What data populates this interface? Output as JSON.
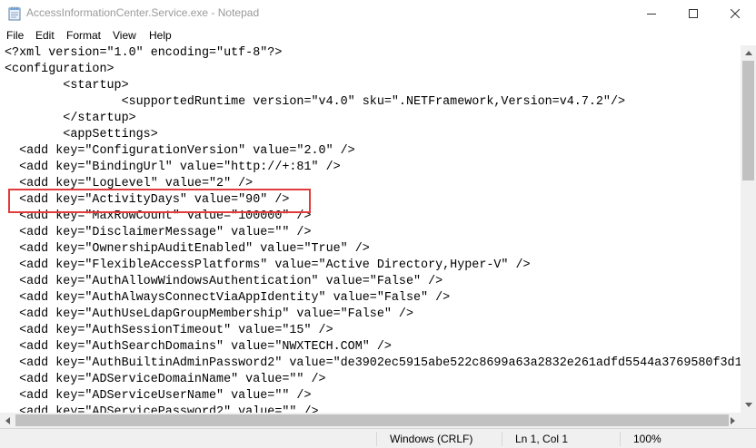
{
  "window": {
    "title": "AccessInformationCenter.Service.exe - Notepad",
    "icon": "notepad-icon",
    "controls": [
      "minimize-icon",
      "maximize-icon",
      "close-icon"
    ]
  },
  "menu": [
    "File",
    "Edit",
    "Format",
    "View",
    "Help"
  ],
  "editor": {
    "lines": [
      "<?xml version=\"1.0\" encoding=\"utf-8\"?>",
      "<configuration>",
      "        <startup>",
      "                <supportedRuntime version=\"v4.0\" sku=\".NETFramework,Version=v4.7.2\"/>",
      "        </startup>",
      "        <appSettings>",
      "  <add key=\"ConfigurationVersion\" value=\"2.0\" />",
      "  <add key=\"BindingUrl\" value=\"http://+:81\" />",
      "  <add key=\"LogLevel\" value=\"2\" />",
      "  <add key=\"ActivityDays\" value=\"90\" />",
      "  <add key=\"MaxRowCount\" value=\"100000\" />",
      "  <add key=\"DisclaimerMessage\" value=\"\" />",
      "  <add key=\"OwnershipAuditEnabled\" value=\"True\" />",
      "  <add key=\"FlexibleAccessPlatforms\" value=\"Active Directory,Hyper-V\" />",
      "  <add key=\"AuthAllowWindowsAuthentication\" value=\"False\" />",
      "  <add key=\"AuthAlwaysConnectViaAppIdentity\" value=\"False\" />",
      "  <add key=\"AuthUseLdapGroupMembership\" value=\"False\" />",
      "  <add key=\"AuthSessionTimeout\" value=\"15\" />",
      "  <add key=\"AuthSearchDomains\" value=\"NWXTECH.COM\" />",
      "  <add key=\"AuthBuiltinAdminPassword2\" value=\"de3902ec5915abe522c8699a63a2832e261adfd5544a3769580f3d1",
      "  <add key=\"ADServiceDomainName\" value=\"\" />",
      "  <add key=\"ADServiceUserName\" value=\"\" />",
      "  <add key=\"ADServicePassword2\" value=\"\" />"
    ],
    "highlighted_line": 9,
    "highlight_color": "#e23b3b"
  },
  "status": {
    "line_endings": "Windows (CRLF)",
    "position": "Ln 1, Col 1",
    "zoom": "100%"
  }
}
